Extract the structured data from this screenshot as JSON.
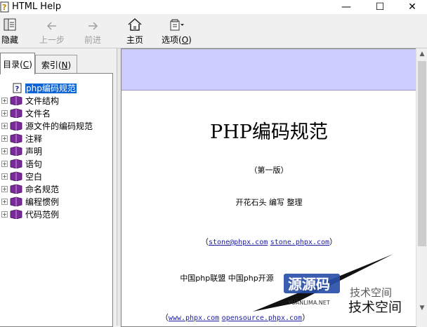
{
  "window": {
    "title": "HTML Help",
    "minimize": "—",
    "maximize": "☐",
    "close": "✕"
  },
  "toolbar": {
    "hide": "隐藏",
    "back": "上一步",
    "forward": "前进",
    "home": "主页",
    "options_prefix": "选项(",
    "options_key": "O",
    "options_suffix": ")"
  },
  "tabs": {
    "contents_prefix": "目录(",
    "contents_key": "C",
    "contents_suffix": ")",
    "index_prefix": "索引(",
    "index_key": "N",
    "index_suffix": ")"
  },
  "tree": {
    "root": "php编码规范",
    "items": [
      "文件结构",
      "文件名",
      "源文件的编码规范",
      "注释",
      "声明",
      "语句",
      "空白",
      "命名规范",
      "编程惯例",
      "代码范例"
    ]
  },
  "document": {
    "title": "PHP编码规范",
    "edition": "（第一版）",
    "authors": "开花石头 编写 整理",
    "contact_open": "（",
    "email": "stone@phpx.com",
    "site": "stone.phpx.com",
    "contact_close": "）",
    "org": "中国php联盟 中国php开源",
    "urls_open": "（",
    "url1": "www.phpx.com",
    "url2": "opensource.phpx.com",
    "urls_close": "）"
  },
  "watermark": {
    "brand": "源源码",
    "slogan": "技术空间",
    "slogan_small": "技术空间",
    "latin": "YUANLIMA.NET"
  },
  "colors": {
    "banner": "#ccccff",
    "selection": "#0a64d8",
    "book": "#7a2a9a",
    "link": "#1a1aa0"
  }
}
